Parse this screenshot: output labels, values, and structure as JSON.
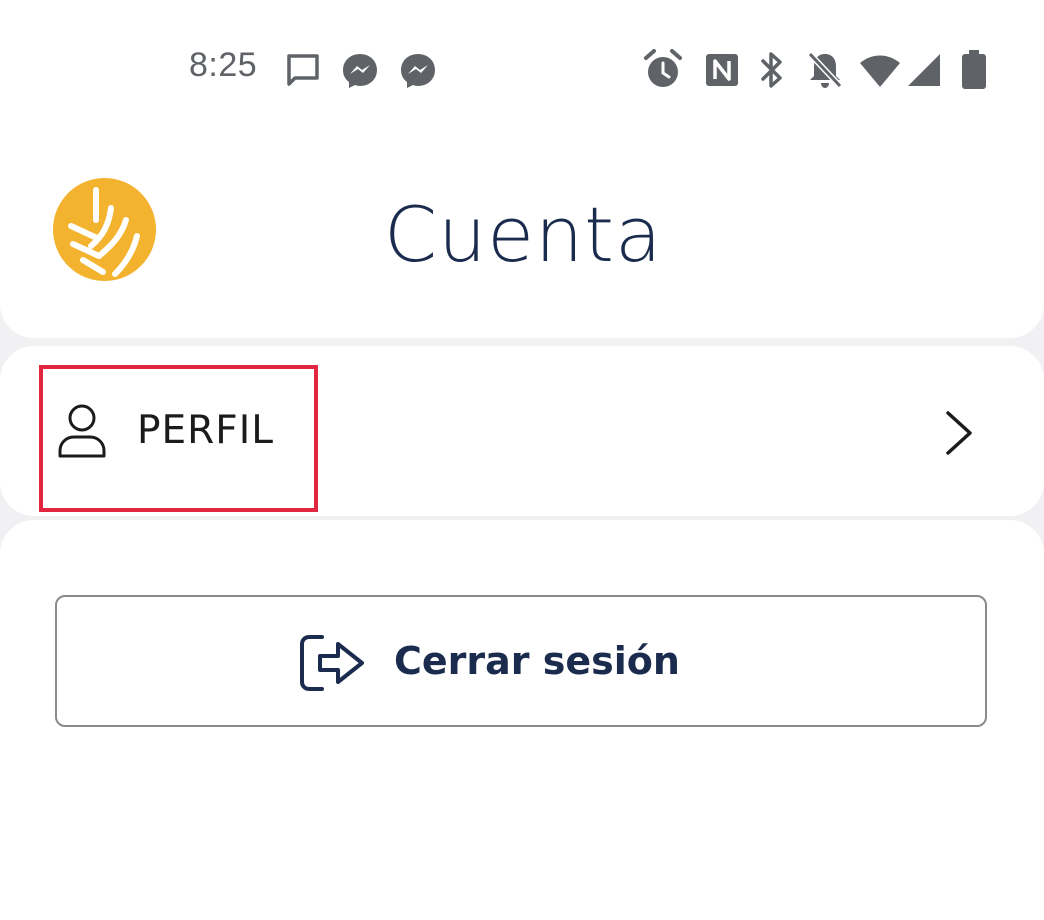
{
  "status_bar": {
    "time": "8:25",
    "left_icons": [
      "message-icon",
      "messenger-icon",
      "messenger-icon"
    ],
    "right_icons": [
      "alarm-icon",
      "nfc-icon",
      "bluetooth-icon",
      "bell-off-icon",
      "wifi-icon",
      "signal-icon",
      "battery-icon"
    ]
  },
  "header": {
    "title": "Cuenta",
    "logo_color": "#f4b32f"
  },
  "profile_row": {
    "label": "PERFIL",
    "icon": "person-icon",
    "trailing_icon": "chevron-right-icon",
    "highlight_color": "#e2263f"
  },
  "logout": {
    "label": "Cerrar sesión",
    "icon": "logout-icon",
    "text_color": "#1a2b4d"
  }
}
